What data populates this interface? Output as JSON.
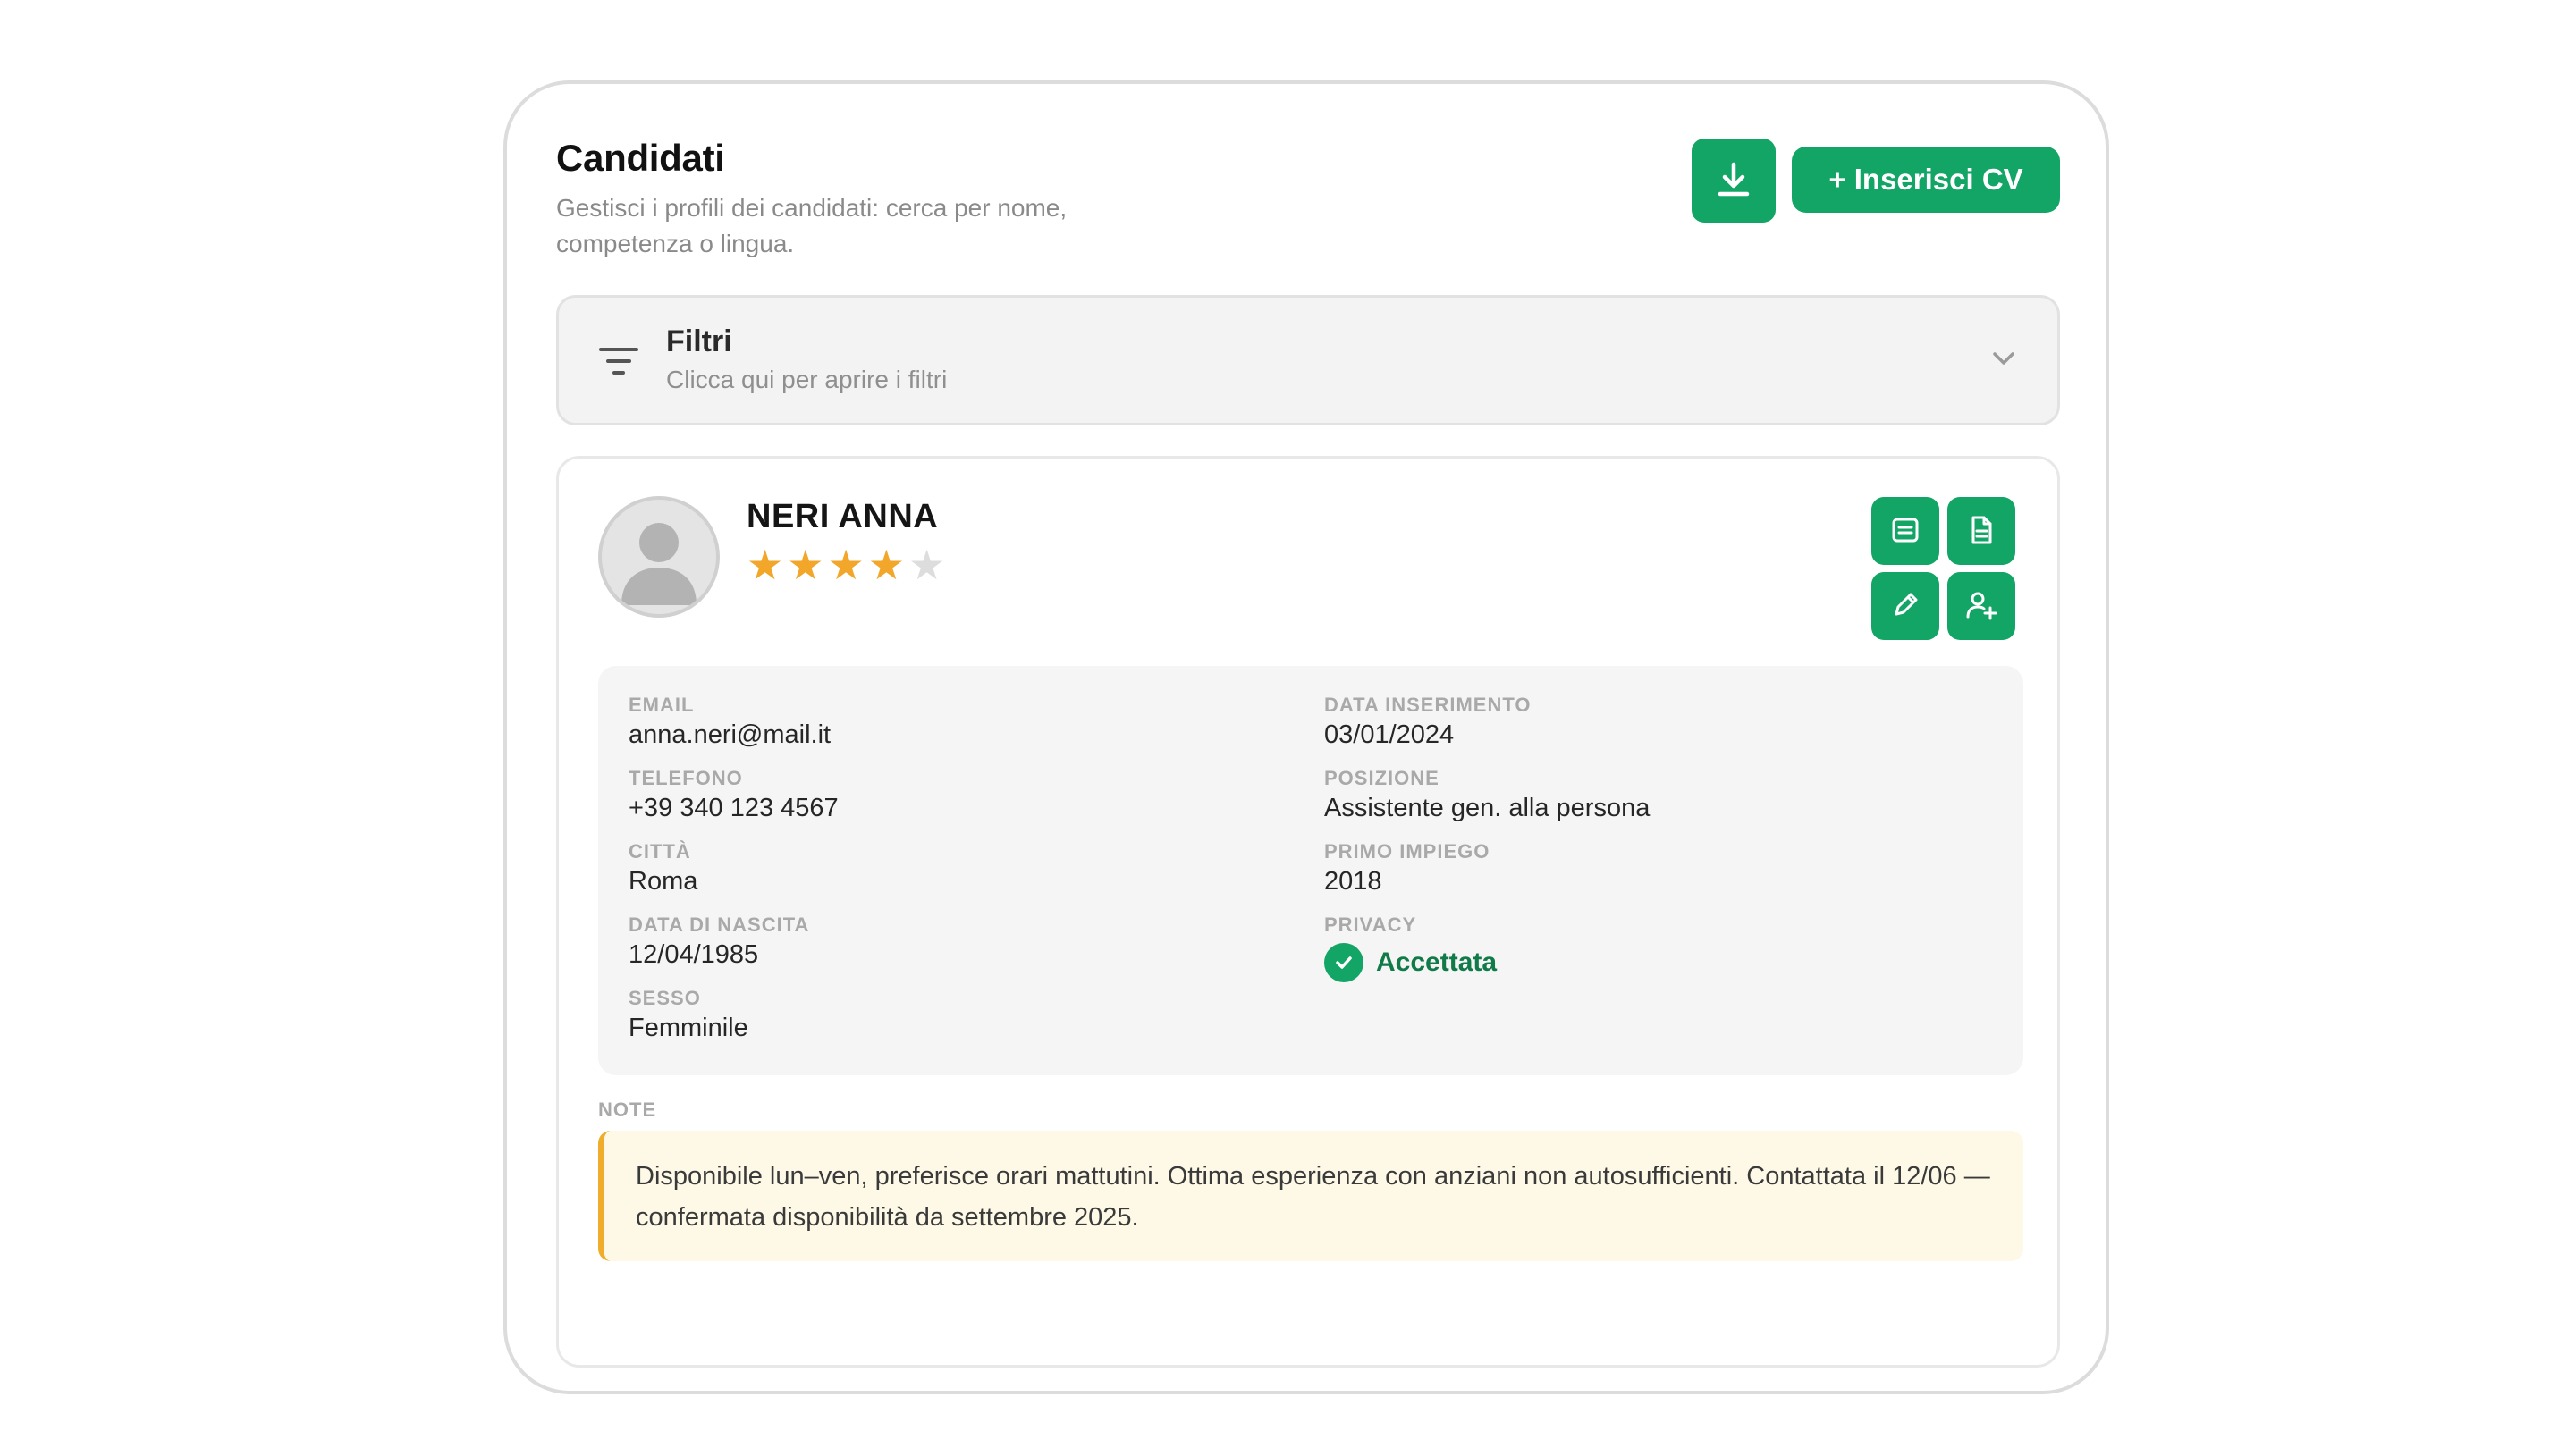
{
  "header": {
    "title": "Candidati",
    "subtitle": "Gestisci i profili dei candidati: cerca per nome, competenza o lingua.",
    "insert_cv_label": "+ Inserisci CV"
  },
  "filters": {
    "title": "Filtri",
    "hint": "Clicca qui per aprire i filtri"
  },
  "candidate": {
    "name": "NERI ANNA",
    "rating": 4,
    "rating_max": 5,
    "details_left": [
      {
        "label": "Email",
        "value": "anna.neri@mail.it"
      },
      {
        "label": "Telefono",
        "value": "+39 340 123 4567"
      },
      {
        "label": "Città",
        "value": "Roma"
      },
      {
        "label": "Data di nascita",
        "value": "12/04/1985"
      },
      {
        "label": "Sesso",
        "value": "Femminile"
      }
    ],
    "details_right": [
      {
        "label": "Data inserimento",
        "value": "03/01/2024"
      },
      {
        "label": "Posizione",
        "value": "Assistente gen. alla persona"
      },
      {
        "label": "Primo impiego",
        "value": "2018"
      }
    ],
    "privacy": {
      "label": "Privacy",
      "value": "Accettata"
    },
    "notes_label": "NOTE",
    "notes": "Disponibile lun–ven, preferisce orari mattutini. Ottima esperienza con anziani non autosufficienti. Contattata il 12/06 — confermata disponibilità da settembre 2025."
  },
  "icons": {
    "download": "download-icon",
    "filter": "filter-icon",
    "chevron": "chevron-down-icon",
    "details": "list-details-icon",
    "document": "document-icon",
    "edit": "pencil-icon",
    "add_user": "user-plus-icon",
    "check": "check-icon"
  },
  "colors": {
    "accent": "#12a565",
    "star": "#f2a62a",
    "note_border": "#f0ad2c",
    "note_bg": "#fef9e6"
  }
}
